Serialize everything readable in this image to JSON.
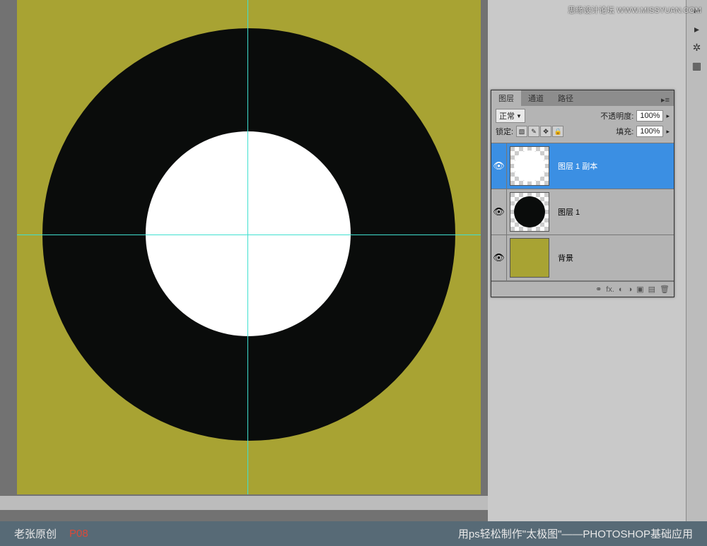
{
  "watermark": "思缘设计论坛 WWW.MISSYUAN.COM",
  "colors": {
    "canvas_bg": "#a8a333",
    "black_circle": "#0a0c0b",
    "white_circle": "#ffffff",
    "guide": "#40e0d0",
    "footer_bg": "#576a76",
    "page_number": "#d94a3a"
  },
  "panel": {
    "tabs": [
      "图层",
      "通道",
      "路径"
    ],
    "active_tab": 0,
    "blend_mode": "正常",
    "opacity_label": "不透明度:",
    "opacity_value": "100%",
    "lock_label": "锁定:",
    "fill_label": "填充:",
    "fill_value": "100%",
    "layers": [
      {
        "name": "图层 1 副本",
        "visible": true,
        "selected": true,
        "thumb": "white-circle"
      },
      {
        "name": "图层 1",
        "visible": true,
        "selected": false,
        "thumb": "black-circle"
      },
      {
        "name": "背景",
        "visible": true,
        "selected": false,
        "thumb": "solid"
      }
    ]
  },
  "footer": {
    "credit": "老张原创",
    "page": "P08",
    "title": "用ps轻松制作\"太极图\"——PHOTOSHOP基础应用"
  }
}
